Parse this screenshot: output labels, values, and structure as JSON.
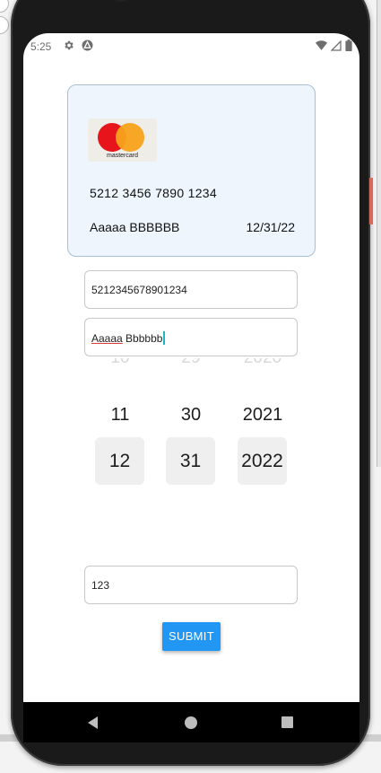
{
  "status_bar": {
    "time": "5:25",
    "left_icons": [
      "gear-icon",
      "app-logo-icon"
    ],
    "right_icons": [
      "wifi-icon",
      "signal-icon",
      "battery-icon"
    ]
  },
  "card_preview": {
    "brand_label": "mastercard",
    "number": "5212 3456 7890 1234",
    "holder_name": "Aaaaa BBBBBB",
    "expiry": "12/31/22",
    "colors": {
      "background": "#eef5fd",
      "border": "#a9bfd6",
      "mc_red": "#e8141c",
      "mc_yellow": "#f7a21b"
    }
  },
  "form": {
    "card_number_value": "5212345678901234",
    "name_value_part1": "Aaaaa",
    "name_value_part2": " Bbbbbb",
    "cvv_value": "123",
    "submit_label": "SUBMIT"
  },
  "date_picker": {
    "month": {
      "faded_prev": "10",
      "prev": "11",
      "selected": "12"
    },
    "day": {
      "faded_prev": "29",
      "prev": "30",
      "selected": "31"
    },
    "year": {
      "faded_prev": "2020",
      "prev": "2021",
      "selected": "2022"
    }
  },
  "colors": {
    "accent": "#2196f3",
    "caret": "#1ab7c4",
    "spellcheck_underline": "#e53935"
  },
  "nav_bar": {
    "buttons": [
      "back-icon",
      "home-icon",
      "recents-icon"
    ]
  }
}
